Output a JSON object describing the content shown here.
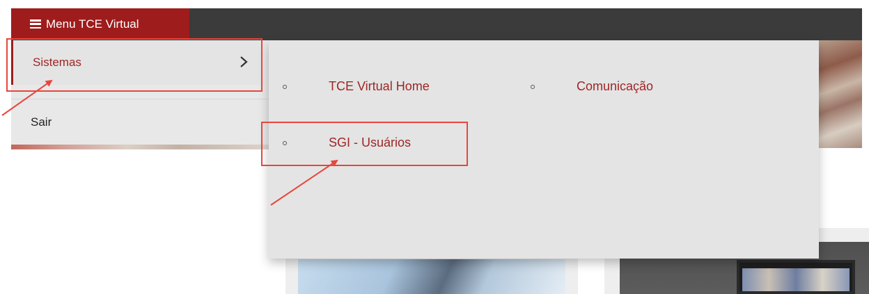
{
  "header": {
    "menu_label": "Menu TCE Virtual"
  },
  "left_menu": {
    "items": [
      {
        "label": "Sistemas",
        "has_submenu": true
      },
      {
        "label": "Sair",
        "has_submenu": false
      }
    ]
  },
  "submenu": {
    "items": [
      {
        "label": "TCE Virtual Home"
      },
      {
        "label": "Comunicação"
      },
      {
        "label": "SGI - Usuários"
      }
    ]
  },
  "colors": {
    "accent": "#9e1c1c",
    "topbar": "#3b3b3b",
    "link": "#9e2525",
    "annotation": "#e8453c"
  },
  "icons": [
    "hamburger-icon",
    "chevron-right-icon"
  ]
}
